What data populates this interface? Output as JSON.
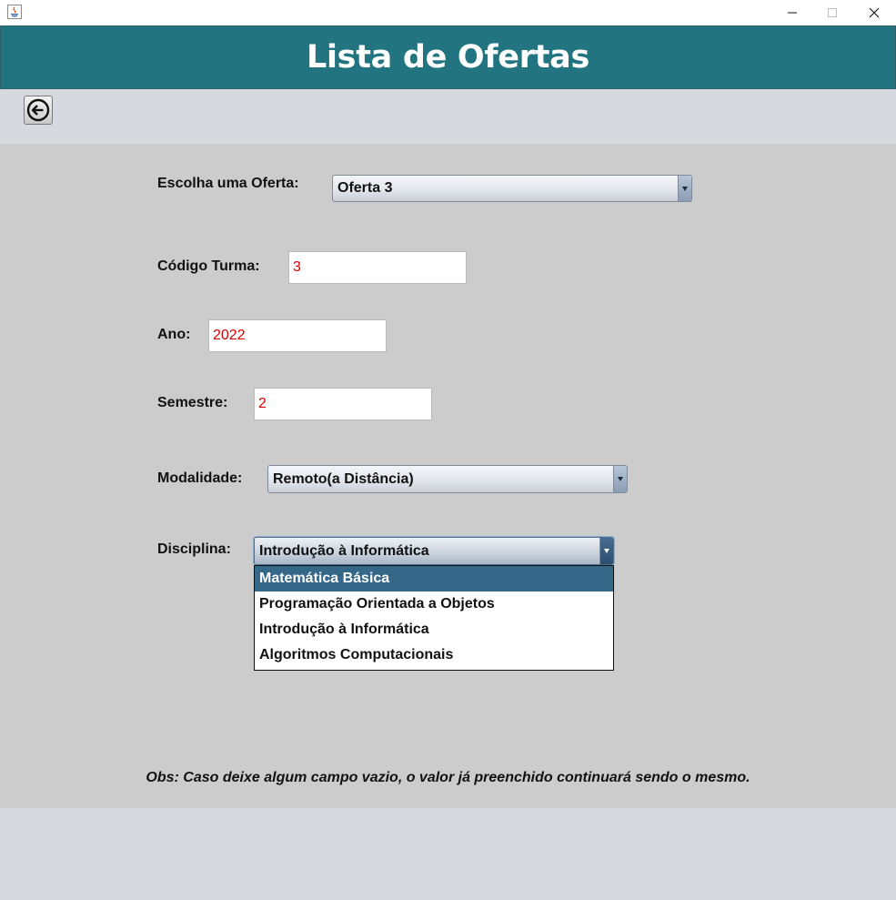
{
  "header": {
    "title": "Lista de Ofertas"
  },
  "form": {
    "oferta": {
      "label": "Escolha uma Oferta:",
      "selected": "Oferta 3"
    },
    "codigo_turma": {
      "label": "Código Turma:",
      "value": "3"
    },
    "ano": {
      "label": "Ano:",
      "value": "2022"
    },
    "semestre": {
      "label": "Semestre:",
      "value": "2"
    },
    "modalidade": {
      "label": "Modalidade:",
      "selected": "Remoto(a Distância)"
    },
    "disciplina": {
      "label": "Disciplina:",
      "selected": "Introdução à Informática",
      "options": [
        "Matemática Básica",
        "Programação Orientada a Objetos",
        "Introdução à Informática",
        "Algoritmos Computacionais"
      ],
      "highlighted_option": "Matemática Básica"
    }
  },
  "footer": {
    "obs": "Obs: Caso deixe algum campo vazio, o valor já preenchido continuará sendo o mesmo."
  },
  "icons": {
    "app": "java-icon",
    "back": "arrow-left-circle-icon",
    "minimize": "minimize-icon",
    "maximize": "maximize-icon",
    "close": "close-icon"
  },
  "colors": {
    "header_bg": "#217480",
    "content_bg": "#cccccc",
    "outer_bg": "#d6d9e0",
    "field_value": "#d90000",
    "list_highlight": "#346788"
  }
}
